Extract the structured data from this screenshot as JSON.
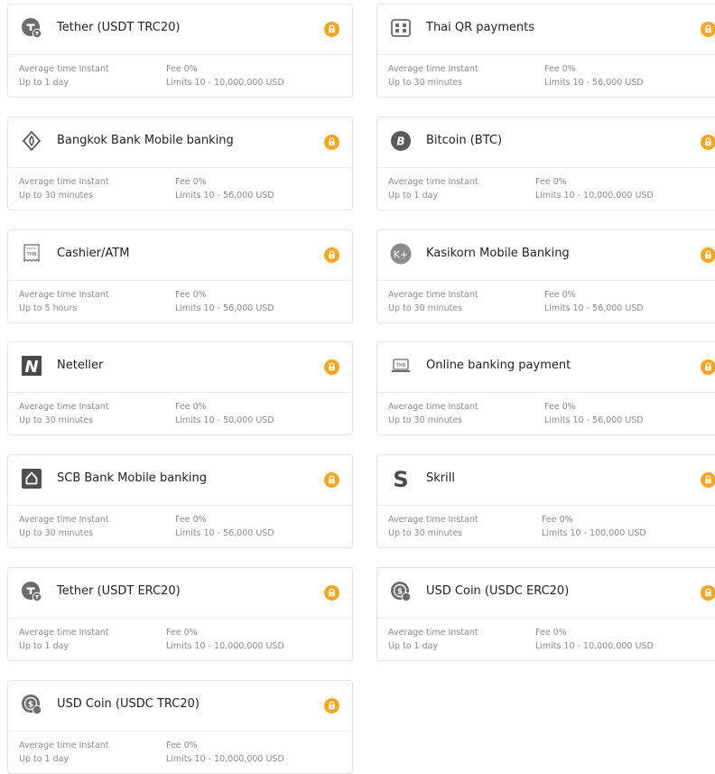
{
  "methods": [
    {
      "name": "Tether (USDT TRC20)",
      "icon": "tether-icon",
      "avg_label": "Average time",
      "avg_value": "Instant",
      "upto_label": "Up to",
      "upto_value": "1 day",
      "fee_label": "Fee",
      "fee_value": "0%",
      "limits_label": "Limits",
      "limits_value": "10 - 10,000,000 USD"
    },
    {
      "name": "Thai QR payments",
      "icon": "qr-code-icon",
      "avg_label": "Average time",
      "avg_value": "Instant",
      "upto_label": "Up to",
      "upto_value": "30 minutes",
      "fee_label": "Fee",
      "fee_value": "0%",
      "limits_label": "Limits",
      "limits_value": "10 - 56,000 USD"
    },
    {
      "name": "Bangkok Bank Mobile banking",
      "icon": "bangkok-bank-icon",
      "avg_label": "Average time",
      "avg_value": "Instant",
      "upto_label": "Up to",
      "upto_value": "30 minutes",
      "fee_label": "Fee",
      "fee_value": "0%",
      "limits_label": "Limits",
      "limits_value": "10 - 56,000 USD"
    },
    {
      "name": "Bitcoin (BTC)",
      "icon": "bitcoin-icon",
      "avg_label": "Average time",
      "avg_value": "Instant",
      "upto_label": "Up to",
      "upto_value": "1 day",
      "fee_label": "Fee",
      "fee_value": "0%",
      "limits_label": "Limits",
      "limits_value": "10 - 10,000,000 USD"
    },
    {
      "name": "Cashier/ATM",
      "icon": "cashier-receipt-icon",
      "icon_text": "THB",
      "avg_label": "Average time",
      "avg_value": "Instant",
      "upto_label": "Up to",
      "upto_value": "5 hours",
      "fee_label": "Fee",
      "fee_value": "0%",
      "limits_label": "Limits",
      "limits_value": "10 - 56,000 USD"
    },
    {
      "name": "Kasikorn Mobile Banking",
      "icon": "kasikorn-icon",
      "icon_text": "K+",
      "avg_label": "Average time",
      "avg_value": "Instant",
      "upto_label": "Up to",
      "upto_value": "30 minutes",
      "fee_label": "Fee",
      "fee_value": "0%",
      "limits_label": "Limits",
      "limits_value": "10 - 56,000 USD"
    },
    {
      "name": "Neteller",
      "icon": "neteller-icon",
      "icon_text": "N",
      "avg_label": "Average time",
      "avg_value": "Instant",
      "upto_label": "Up to",
      "upto_value": "30 minutes",
      "fee_label": "Fee",
      "fee_value": "0%",
      "limits_label": "Limits",
      "limits_value": "10 - 50,000 USD"
    },
    {
      "name": "Online banking payment",
      "icon": "laptop-icon",
      "icon_text": "THB",
      "avg_label": "Average time",
      "avg_value": "Instant",
      "upto_label": "Up to",
      "upto_value": "30 minutes",
      "fee_label": "Fee",
      "fee_value": "0%",
      "limits_label": "Limits",
      "limits_value": "10 - 56,000 USD"
    },
    {
      "name": "SCB Bank Mobile banking",
      "icon": "scb-bank-icon",
      "avg_label": "Average time",
      "avg_value": "Instant",
      "upto_label": "Up to",
      "upto_value": "30 minutes",
      "fee_label": "Fee",
      "fee_value": "0%",
      "limits_label": "Limits",
      "limits_value": "10 - 56,000 USD"
    },
    {
      "name": "Skrill",
      "icon": "skrill-icon",
      "icon_text": "S",
      "avg_label": "Average time",
      "avg_value": "Instant",
      "upto_label": "Up to",
      "upto_value": "30 minutes",
      "fee_label": "Fee",
      "fee_value": "0%",
      "limits_label": "Limits",
      "limits_value": "10 - 100,000 USD"
    },
    {
      "name": "Tether (USDT ERC20)",
      "icon": "tether-icon",
      "avg_label": "Average time",
      "avg_value": "Instant",
      "upto_label": "Up to",
      "upto_value": "1 day",
      "fee_label": "Fee",
      "fee_value": "0%",
      "limits_label": "Limits",
      "limits_value": "10 - 10,000,000 USD"
    },
    {
      "name": "USD Coin (USDC ERC20)",
      "icon": "usdc-icon",
      "avg_label": "Average time",
      "avg_value": "Instant",
      "upto_label": "Up to",
      "upto_value": "1 day",
      "fee_label": "Fee",
      "fee_value": "0%",
      "limits_label": "Limits",
      "limits_value": "10 - 10,000,000 USD"
    },
    {
      "name": "USD Coin (USDC TRC20)",
      "icon": "usdc-icon",
      "avg_label": "Average time",
      "avg_value": "Instant",
      "upto_label": "Up to",
      "upto_value": "1 day",
      "fee_label": "Fee",
      "fee_value": "0%",
      "limits_label": "Limits",
      "limits_value": "10 - 10,000,000 USD"
    }
  ],
  "colors": {
    "lock_accent": "#f5a623",
    "icon_gray": "#6b6b6b",
    "text_muted": "#8a8a8a",
    "border": "#e4e4e4"
  },
  "lock_icon": "lock-icon"
}
